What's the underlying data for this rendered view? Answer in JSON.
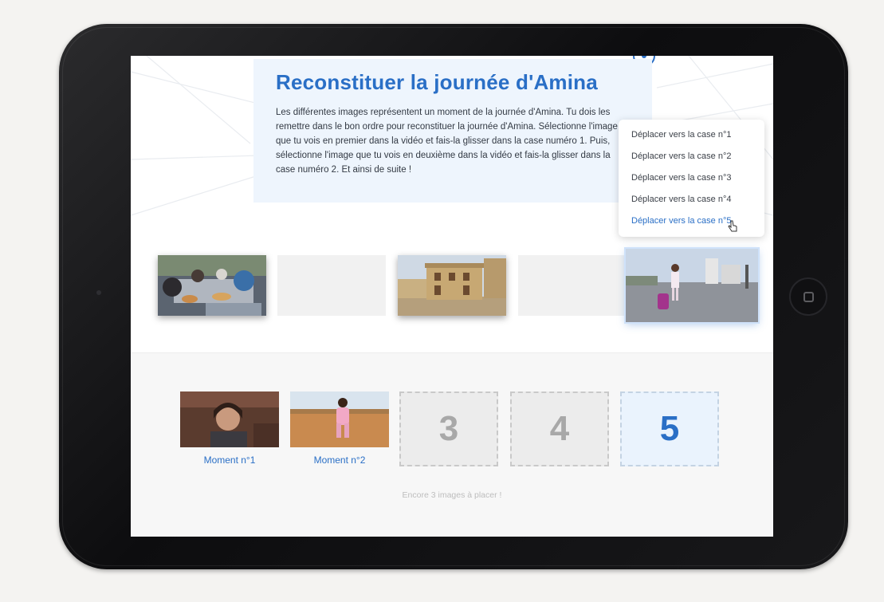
{
  "activity": {
    "title": "Reconstituer la journée d'Amina",
    "instructions": "Les différentes images représentent un moment de la journée d'Amina. Tu dois les remettre dans le bon ordre pour reconstituer la journée d'Amina. Sélectionne l'image que tu vois en premier dans la vidéo et fais-la glisser dans la case numéro 1. Puis, sélectionne l'image que tu vois en deuxième dans la vidéo et fais-la glisser dans la case numéro 2. Et ainsi de suite !"
  },
  "context_menu": {
    "items": [
      {
        "label": "Déplacer vers la case n°1"
      },
      {
        "label": "Déplacer vers la case n°2"
      },
      {
        "label": "Déplacer vers la case n°3"
      },
      {
        "label": "Déplacer vers la case n°4"
      },
      {
        "label": "Déplacer vers la case n°5",
        "hovered": true
      }
    ]
  },
  "image_bank": [
    {
      "scene": "family meal outdoors",
      "state": "available"
    },
    {
      "scene": "",
      "state": "empty"
    },
    {
      "scene": "house with yellow walls",
      "state": "available"
    },
    {
      "scene": "",
      "state": "empty"
    },
    {
      "scene": "girl walking on road with luggage",
      "state": "selected"
    }
  ],
  "drop_slots": [
    {
      "number": "1",
      "label": "Moment n°1",
      "state": "filled",
      "scene": "smiling woman"
    },
    {
      "number": "2",
      "label": "Moment n°2",
      "state": "filled",
      "scene": "girl running in desert"
    },
    {
      "number": "3",
      "label": "",
      "state": "empty"
    },
    {
      "number": "4",
      "label": "",
      "state": "empty"
    },
    {
      "number": "5",
      "label": "",
      "state": "target"
    }
  ],
  "status": {
    "remaining": "Encore 3 images à placer !"
  },
  "colors": {
    "accent": "#2a6fc6",
    "panel": "#eef5fd",
    "tablet_frame": "#111113"
  }
}
